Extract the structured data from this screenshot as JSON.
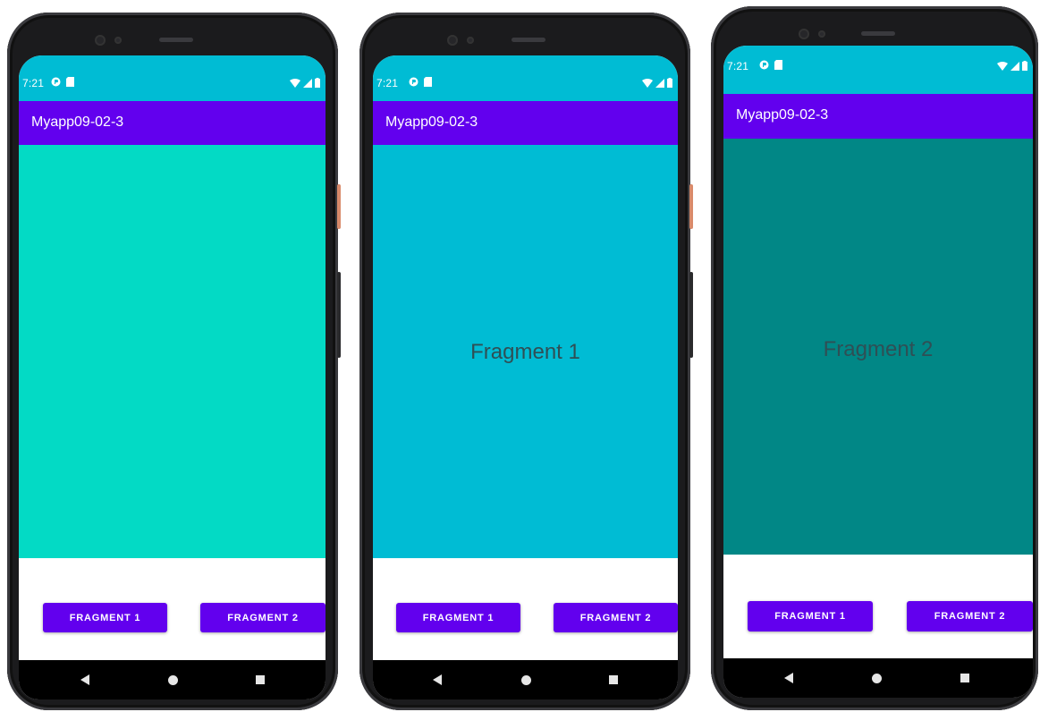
{
  "status_bar": {
    "time": "7:21"
  },
  "app": {
    "title": "Myapp09-02-3"
  },
  "colors": {
    "status_bar": "#00bcd4",
    "app_bar": "#6200ee",
    "fragment_initial": "#03dac5",
    "fragment_1": "#00bcd4",
    "fragment_2": "#018786",
    "button": "#6200ee",
    "nav_bar": "#000000"
  },
  "phones": [
    {
      "fragment_text": "",
      "buttons": {
        "fragment_1": "FRAGMENT 1",
        "fragment_2": "FRAGMENT 2"
      }
    },
    {
      "fragment_text": "Fragment 1",
      "buttons": {
        "fragment_1": "FRAGMENT 1",
        "fragment_2": "FRAGMENT 2"
      }
    },
    {
      "fragment_text": "Fragment 2",
      "buttons": {
        "fragment_1": "FRAGMENT 1",
        "fragment_2": "FRAGMENT 2"
      }
    }
  ],
  "icons": {
    "status_left": [
      "privacy-indicator-icon",
      "sd-card-icon"
    ],
    "status_right": [
      "wifi-icon",
      "cell-signal-icon",
      "battery-icon"
    ],
    "nav": [
      "back-icon",
      "home-icon",
      "recents-icon"
    ]
  }
}
